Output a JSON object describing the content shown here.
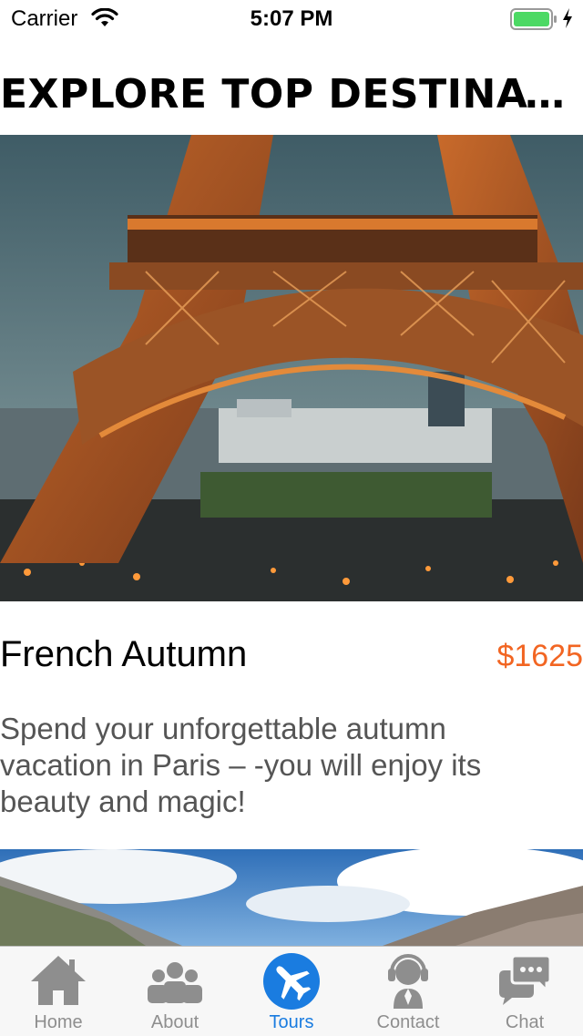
{
  "status_bar": {
    "carrier": "Carrier",
    "time": "5:07 PM",
    "battery_color": "#4cd964"
  },
  "page": {
    "title": "EXPLORE TOP DESTINAT…"
  },
  "tours": [
    {
      "image": "eiffel-tower-photo",
      "name": "French Autumn",
      "price": "$1625",
      "description": "Spend your unforgettable autumn vacation in Paris – -you will enjoy its beauty and magic!"
    },
    {
      "image": "mountain-landscape-photo"
    }
  ],
  "tab_bar": {
    "active_color": "#1a7ce0",
    "inactive_color": "#8e8e8e",
    "items": [
      {
        "label": "Home",
        "icon": "home-icon"
      },
      {
        "label": "About",
        "icon": "people-icon"
      },
      {
        "label": "Tours",
        "icon": "airplane-icon",
        "active": true
      },
      {
        "label": "Contact",
        "icon": "headset-icon"
      },
      {
        "label": "Chat",
        "icon": "chat-bubbles-icon"
      }
    ]
  }
}
